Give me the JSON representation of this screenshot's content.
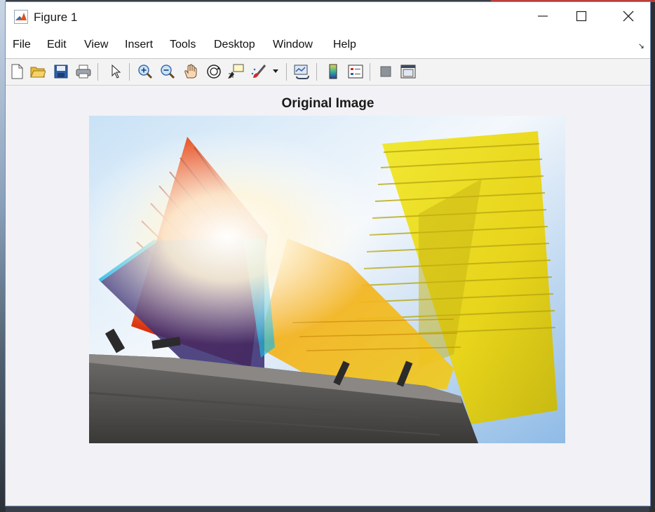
{
  "window": {
    "title": "Figure 1",
    "app_icon": "matlab-icon",
    "controls": [
      "minimize-icon",
      "maximize-icon",
      "close-icon"
    ]
  },
  "menu": {
    "items": [
      "File",
      "Edit",
      "View",
      "Insert",
      "Tools",
      "Desktop",
      "Window",
      "Help"
    ],
    "dock_icon": "dock-arrow-icon"
  },
  "toolbar": {
    "icons": [
      "new-figure-icon",
      "open-file-icon",
      "save-icon",
      "print-icon",
      "pointer-icon",
      "zoom-in-icon",
      "zoom-out-icon",
      "pan-hand-icon",
      "rotate-3d-icon",
      "data-cursor-icon",
      "brush-icon",
      "brush-dropdown-icon",
      "link-plot-icon",
      "colorbar-icon",
      "legend-icon",
      "hide-plot-tools-icon",
      "show-plot-tools-icon"
    ]
  },
  "axes": {
    "title": "Original Image"
  },
  "colors": {
    "window_border": "#6f8fbf",
    "figure_background": "#f2f1f5",
    "menu_background": "#ffffff"
  }
}
